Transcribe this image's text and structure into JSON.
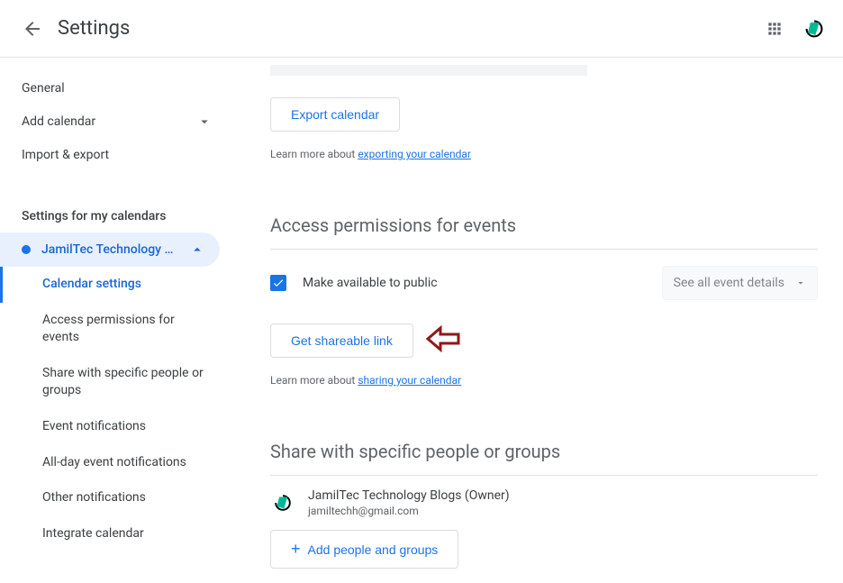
{
  "header": {
    "title": "Settings"
  },
  "sidebar": {
    "general": "General",
    "add_calendar": "Add calendar",
    "import_export": "Import & export",
    "section_title": "Settings for my calendars",
    "calendar_name": "JamilTec Technology …",
    "subnav": {
      "calendar_settings": "Calendar settings",
      "access_permissions": "Access permissions for events",
      "share_specific": "Share with specific people or groups",
      "event_notifications": "Event notifications",
      "allday_notifications": "All-day event notifications",
      "other_notifications": "Other notifications",
      "integrate_calendar": "Integrate calendar"
    }
  },
  "main": {
    "export_btn": "Export calendar",
    "learn_export_prefix": "Learn more about ",
    "learn_export_link": "exporting your calendar",
    "access_heading": "Access permissions for events",
    "public_label": "Make available to public",
    "visibility_select": "See all event details",
    "share_link_btn": "Get shareable link",
    "learn_share_prefix": "Learn more about ",
    "learn_share_link": "sharing your calendar",
    "share_heading": "Share with specific people or groups",
    "owner": {
      "name": "JamilTec Technology Blogs (Owner)",
      "email": "jamiltechh@gmail.com"
    },
    "add_people_btn": "Add people and groups"
  }
}
